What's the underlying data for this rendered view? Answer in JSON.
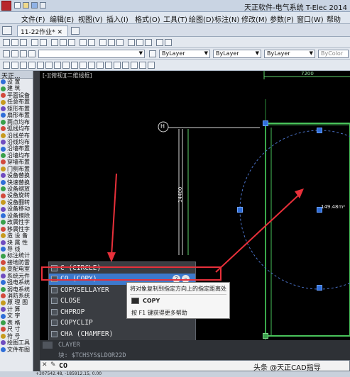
{
  "app": {
    "title": "天正软件-电气系统 T-Elec 2014"
  },
  "menu": [
    "文件(F)",
    "编辑(E)",
    "视图(V)",
    "插入(I)",
    "格式(O)",
    "工具(T)",
    "绘图(D)",
    "标注(N)",
    "修改(M)",
    "参数(P)",
    "窗口(W)",
    "帮助"
  ],
  "tabs": [
    {
      "label": "11-22作业*"
    }
  ],
  "properties": {
    "layer1": "ByLayer",
    "layer2": "ByLayer",
    "layer3": "ByLayer",
    "color": "ByColor"
  },
  "sidebar": {
    "header": "天正...",
    "items": [
      "设 置",
      "建 筑",
      "平面设备",
      "任意布置",
      "矩形布置",
      "扇形布置",
      "两点均布",
      "弧线均布",
      "沿线单布",
      "沿线均布",
      "沿墙布置",
      "沿墙均布",
      "穿墙布置",
      "门侧布置",
      "设备替换",
      "快速替换",
      "设备缩放",
      "设备旋转",
      "设备翻转",
      "设备移动",
      "设备擦除",
      "改属性字",
      "移属性字",
      "造 设 备",
      "块 属 性",
      "导 线",
      "标注统计",
      "接地防雷",
      "变配电室",
      "系统元件",
      "强电系统",
      "弱电系统",
      "消防系统",
      "原 理 图",
      "计 算",
      "文 字",
      "表 格",
      "尺 寸",
      "符 号",
      "绘图工具",
      "文件布图"
    ]
  },
  "canvas": {
    "view_label": "[-][俯视][二维线框]",
    "grid_bubble": "H",
    "dim_top": "7200",
    "dim_side": "14400",
    "area_label": "149.48m²"
  },
  "autocomplete": {
    "items": [
      {
        "label": "C (CIRCLE)",
        "selected": false
      },
      {
        "label": "CO (COPY)",
        "selected": true
      },
      {
        "label": "COPYSELLAYER",
        "selected": false
      },
      {
        "label": "CLOSE",
        "selected": false
      },
      {
        "label": "CHPROP",
        "selected": false
      },
      {
        "label": "COPYCLIP",
        "selected": false
      },
      {
        "label": "CHA (CHAMFER)",
        "selected": false
      }
    ],
    "help_glyph": "?"
  },
  "tooltip": {
    "description": "将对象复制到指定方向上的指定距离处",
    "command": "COPY",
    "help_hint": "按 F1 键获得更多帮助"
  },
  "command_history": [
    "CLAYER",
    "块: $TCHSYS$LDOR22D"
  ],
  "command_input": {
    "prompt_icon": "✎",
    "value": "CO"
  },
  "status": {
    "coords": "+307542.48, -185912.15, 0.00"
  },
  "watermark": "头条 @天正CAD指导",
  "colors": {
    "accent": "#3d79cc",
    "annotation": "#e8303a",
    "grip": "#2f6ed8",
    "wall": "#49c25a"
  }
}
